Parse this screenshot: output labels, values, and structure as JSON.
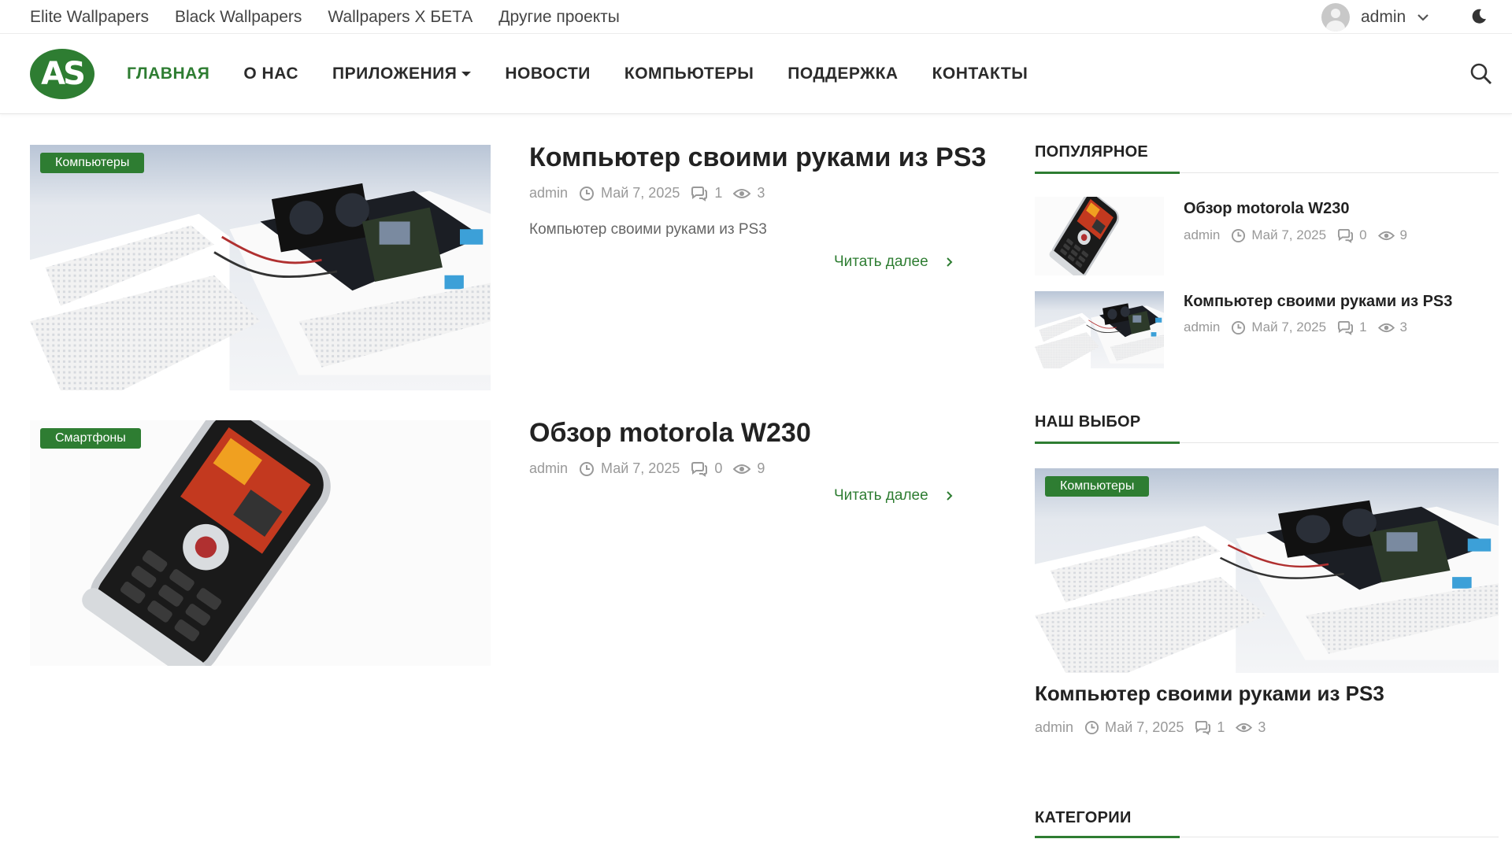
{
  "topbar": {
    "links": [
      "Elite Wallpapers",
      "Black Wallpapers",
      "Wallpapers X БЕТА",
      "Другие проекты"
    ],
    "user_name": "admin"
  },
  "nav": {
    "logo_text": "AS",
    "items": [
      "ГЛАВНАЯ",
      "О НАС",
      "ПРИЛОЖЕНИЯ",
      "НОВОСТИ",
      "КОМПЬЮТЕРЫ",
      "ПОДДЕРЖКА",
      "КОНТАКТЫ"
    ]
  },
  "posts": [
    {
      "category": "Компьютеры",
      "title": "Компьютер своими руками из PS3",
      "author": "admin",
      "date": "Май 7, 2025",
      "comments": "1",
      "views": "3",
      "excerpt": "Компьютер своими руками из PS3",
      "read_more": "Читать далее"
    },
    {
      "category": "Смартфоны",
      "title": "Обзор motorola W230",
      "author": "admin",
      "date": "Май 7, 2025",
      "comments": "0",
      "views": "9",
      "excerpt": "",
      "read_more": "Читать далее"
    }
  ],
  "sidebar": {
    "popular_title": "ПОПУЛЯРНОЕ",
    "popular": [
      {
        "title": "Обзор motorola W230",
        "author": "admin",
        "date": "Май 7, 2025",
        "comments": "0",
        "views": "9"
      },
      {
        "title": "Компьютер своими руками из PS3",
        "author": "admin",
        "date": "Май 7, 2025",
        "comments": "1",
        "views": "3"
      }
    ],
    "choice_title": "НАШ ВЫБОР",
    "choice": {
      "category": "Компьютеры",
      "title": "Компьютер своими руками из PS3",
      "author": "admin",
      "date": "Май 7, 2025",
      "comments": "1",
      "views": "3"
    },
    "categories_title": "КАТЕГОРИИ"
  },
  "colors": {
    "accent": "#2e7d32",
    "text": "#222222",
    "muted": "#999999"
  },
  "icons": [
    "user-avatar-icon",
    "chevron-down-icon",
    "moon-icon",
    "search-icon",
    "clock-icon",
    "comment-icon",
    "eye-icon",
    "chevron-right-icon"
  ]
}
